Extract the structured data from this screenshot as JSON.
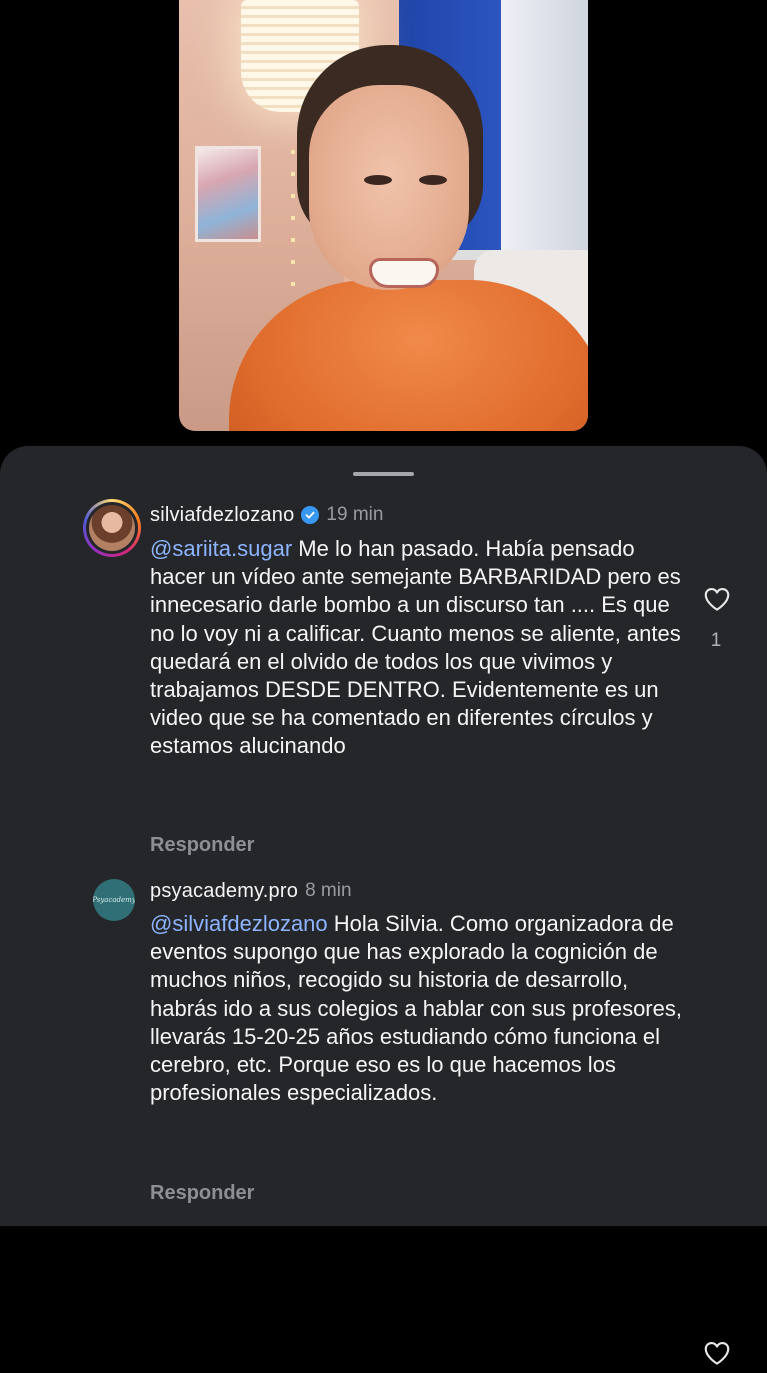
{
  "comments": [
    {
      "username": "silviafdezlozano",
      "verified": true,
      "time": "19 min",
      "mention": "@sariita.sugar",
      "text": "Me lo han pasado. Había pensado hacer un vídeo ante semejante BARBARIDAD pero es innecesario darle bombo a un discurso tan .... Es que no lo voy ni a calificar. Cuanto menos se aliente, antes quedará en el olvido de todos los que vivimos y trabajamos DESDE DENTRO. Evidentemente es un video que se ha comentado en diferentes círculos y estamos alucinando",
      "reply_label": "Responder",
      "likes": "1",
      "like_icon": "heart-outline-icon"
    },
    {
      "username": "psyacademy.pro",
      "verified": false,
      "time": "8 min",
      "mention": "@silviafdezlozano",
      "text": "Hola Silvia. Como organizadora de eventos supongo que has explorado la cognición de muchos niños, recogido su historia de desarrollo, habrás ido a sus colegios a hablar con sus profesores, llevarás 15-20-25 años estudiando cómo funciona el cerebro, etc. Porque eso es lo que hacemos los profesionales especializados.",
      "reply_label": "Responder",
      "avatar_text": "Psyacademy",
      "like_icon": "heart-outline-icon"
    }
  ],
  "colors": {
    "sheet_bg": "#25262a",
    "mention": "#8db4ff",
    "verified": "#3897f0",
    "muted": "#9a9ba0"
  }
}
